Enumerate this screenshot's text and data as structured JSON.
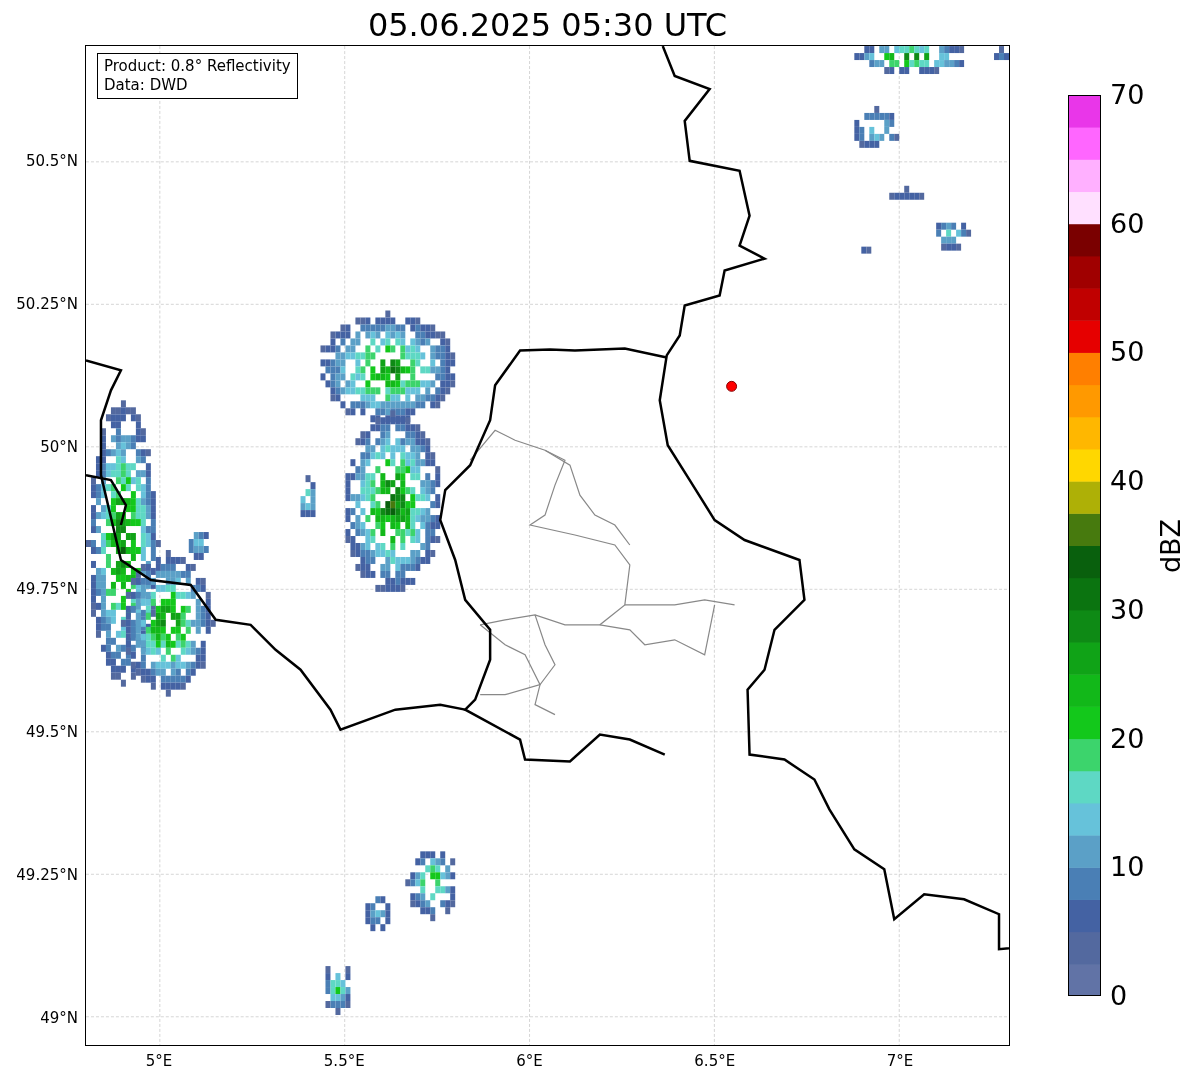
{
  "title": "05.06.2025 05:30 UTC",
  "legend": [
    "Product: 0.8° Reflectivity",
    "Data: DWD"
  ],
  "map": {
    "y_ticks": [
      "50.5°N",
      "50.25°N",
      "50°N",
      "49.75°N",
      "49.5°N",
      "49.25°N",
      "49°N"
    ],
    "x_ticks": [
      "5°E",
      "5.5°E",
      "6°E",
      "6.5°E",
      "7°E"
    ]
  },
  "colorbar": {
    "label": "dBZ",
    "ticks": [
      "70",
      "60",
      "50",
      "40",
      "30",
      "20",
      "10",
      "0"
    ]
  }
}
